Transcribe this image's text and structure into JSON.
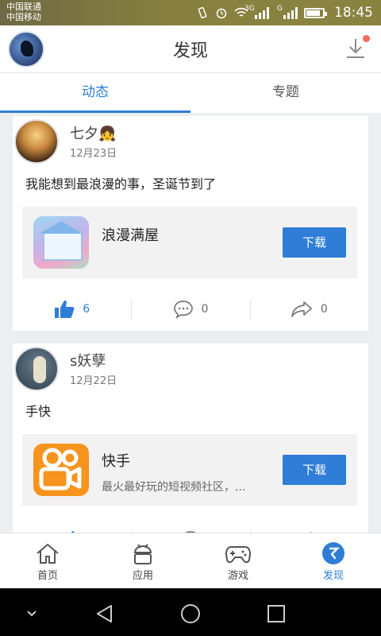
{
  "status_bar": {
    "carrier_1": "中国联通",
    "carrier_2": "中国移动",
    "network_1": "3G",
    "network_2": "G",
    "time": "18:45"
  },
  "header": {
    "title": "发现",
    "download_icon": "download-icon",
    "badge_color": "#f26a5f"
  },
  "tabs": [
    {
      "label": "动态",
      "active": true
    },
    {
      "label": "专题",
      "active": false
    }
  ],
  "posts": [
    {
      "user": "七夕👧",
      "date": "12月23日",
      "text": "我能想到最浪漫的事，圣诞节到了",
      "app": {
        "name": "浪漫满屋",
        "description": "",
        "button": "下载",
        "icon": "app-icon-house"
      },
      "likes": "6",
      "comments": "0",
      "shares": "0",
      "liked": true
    },
    {
      "user": "s妖孽",
      "date": "12月22日",
      "text": "手快",
      "app": {
        "name": "快手",
        "description": "最火最好玩的短视频社区，...",
        "button": "下载",
        "icon": "app-icon-kuaishou"
      },
      "likes": "",
      "comments": "",
      "shares": "",
      "liked": true
    }
  ],
  "bottom_nav": [
    {
      "label": "首页",
      "icon": "home-icon"
    },
    {
      "label": "应用",
      "icon": "android-icon"
    },
    {
      "label": "游戏",
      "icon": "gamepad-icon"
    },
    {
      "label": "发现",
      "icon": "discover-icon",
      "active": true
    }
  ],
  "colors": {
    "accent": "#2f7dd6",
    "status_bar": "#87803f",
    "background": "#eceff1"
  }
}
